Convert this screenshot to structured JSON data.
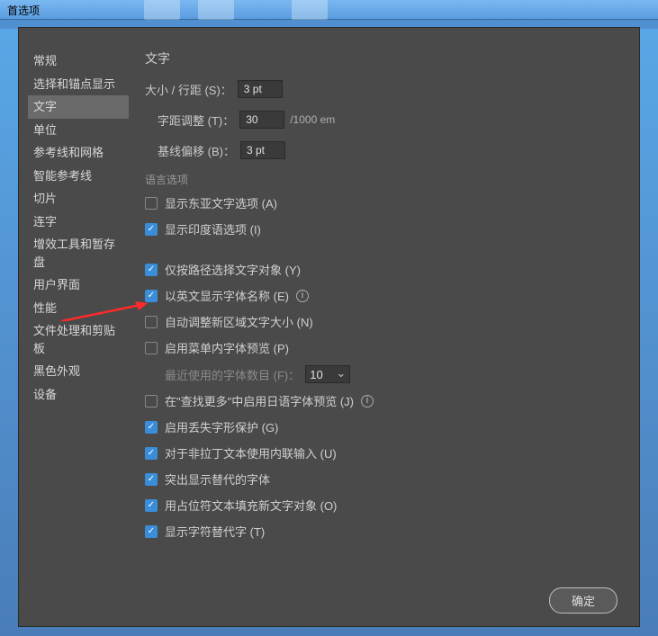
{
  "window": {
    "title": "首选项"
  },
  "sidebar": {
    "items": [
      {
        "label": "常规",
        "selected": false
      },
      {
        "label": "选择和锚点显示",
        "selected": false
      },
      {
        "label": "文字",
        "selected": true
      },
      {
        "label": "单位",
        "selected": false
      },
      {
        "label": "参考线和网格",
        "selected": false
      },
      {
        "label": "智能参考线",
        "selected": false
      },
      {
        "label": "切片",
        "selected": false
      },
      {
        "label": "连字",
        "selected": false
      },
      {
        "label": "增效工具和暂存盘",
        "selected": false
      },
      {
        "label": "用户界面",
        "selected": false
      },
      {
        "label": "性能",
        "selected": false
      },
      {
        "label": "文件处理和剪贴板",
        "selected": false
      },
      {
        "label": "黑色外观",
        "selected": false
      },
      {
        "label": "设备",
        "selected": false
      }
    ]
  },
  "panel": {
    "title": "文字",
    "size_label": "大小 / 行距 (S)：",
    "size_value": "3 pt",
    "tracking_label": "字距调整 (T)：",
    "tracking_value": "30",
    "tracking_unit": "/1000 em",
    "baseline_label": "基线偏移 (B)：",
    "baseline_value": "3 pt",
    "lang_header": "语言选项",
    "checks": {
      "east_asian": {
        "label": "显示东亚文字选项 (A)",
        "checked": false
      },
      "indic": {
        "label": "显示印度语选项 (I)",
        "checked": true
      },
      "by_path": {
        "label": "仅按路径选择文字对象 (Y)",
        "checked": true
      },
      "eng_names": {
        "label": "以英文显示字体名称 (E)",
        "checked": true,
        "info": true
      },
      "auto_size": {
        "label": "自动调整新区域文字大小 (N)",
        "checked": false
      },
      "menu_prev": {
        "label": "启用菜单内字体预览 (P)",
        "checked": false
      },
      "recent": {
        "label": "最近使用的字体数目 (F)：",
        "disabled": true,
        "value": "10"
      },
      "jp_find": {
        "label": "在\"查找更多\"中启用日语字体预览 (J)",
        "checked": false,
        "info": true
      },
      "glyph_prot": {
        "label": "启用丢失字形保护 (G)",
        "checked": true
      },
      "inline_ime": {
        "label": "对于非拉丁文本使用内联输入 (U)",
        "checked": true
      },
      "highlight": {
        "label": "突出显示替代的字体",
        "checked": true
      },
      "placeholder": {
        "label": "用占位符文本填充新文字对象 (O)",
        "checked": true
      },
      "alt_glyph": {
        "label": "显示字符替代字 (T)",
        "checked": true
      }
    }
  },
  "footer": {
    "ok": "确定"
  }
}
